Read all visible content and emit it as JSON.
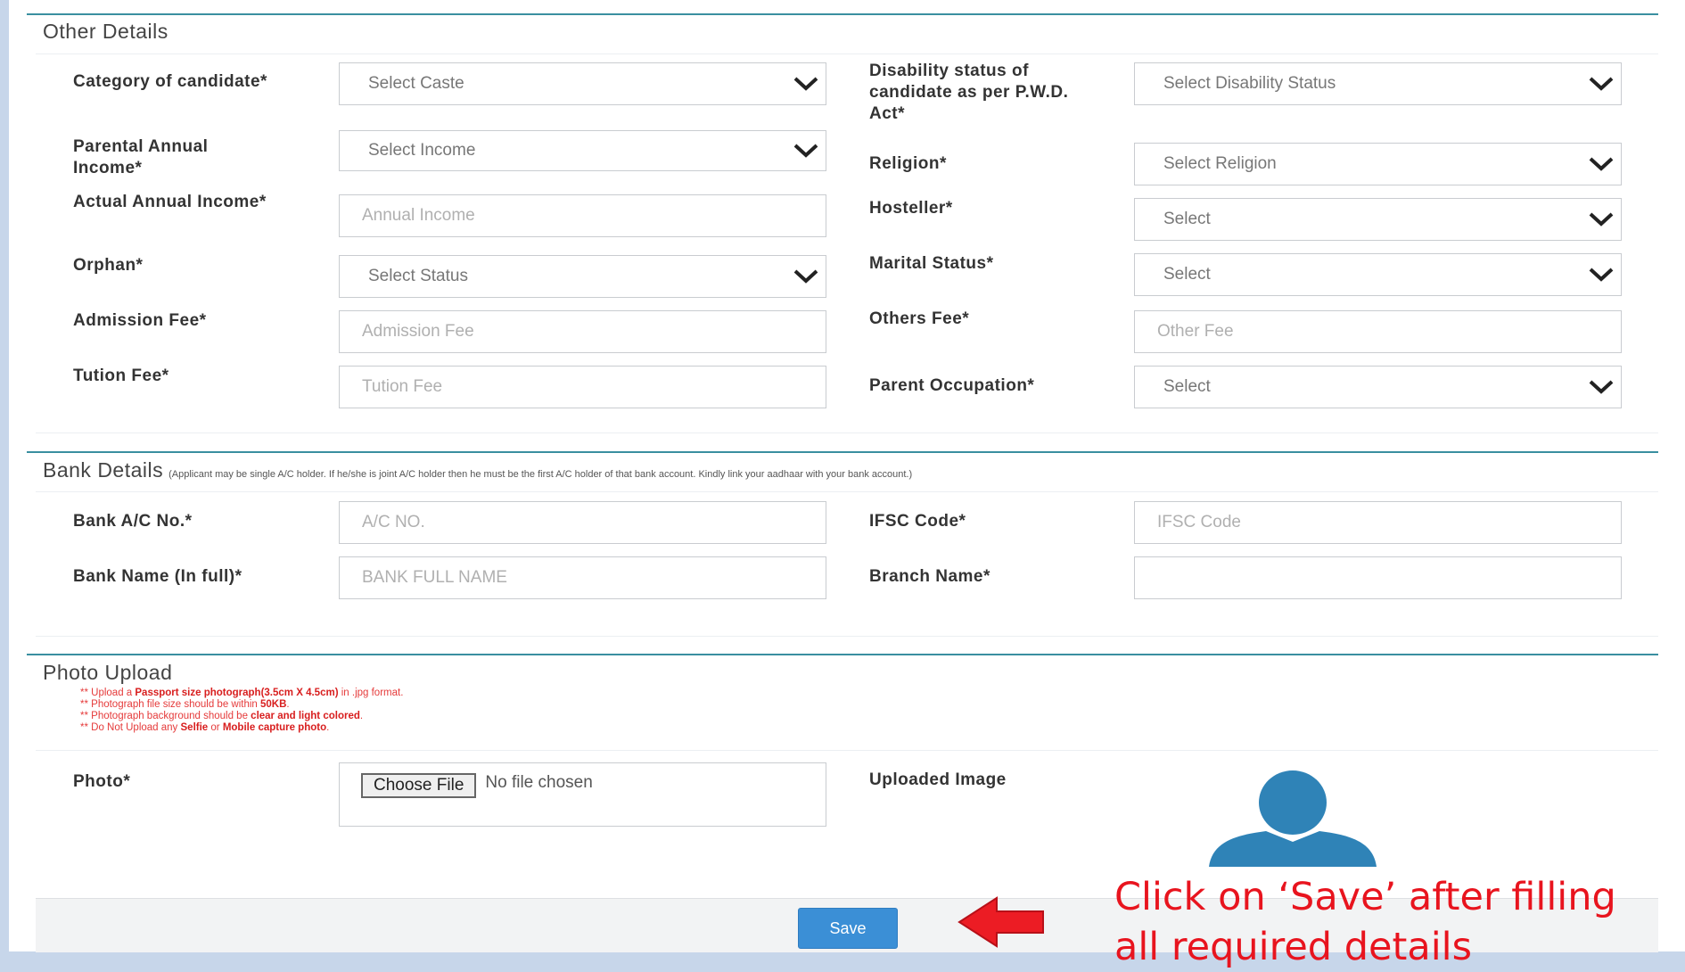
{
  "other_details": {
    "title": "Other Details",
    "fields": {
      "category": {
        "label": "Category of candidate*",
        "value": "Select Caste"
      },
      "disability": {
        "label": "Disability status of candidate as per P.W.D. Act*",
        "value": "Select Disability Status"
      },
      "parental_income": {
        "label": "Parental Annual Income*",
        "value": "Select Income"
      },
      "religion": {
        "label": "Religion*",
        "value": "Select Religion"
      },
      "actual_income": {
        "label": "Actual Annual Income*",
        "placeholder": "Annual Income"
      },
      "hosteller": {
        "label": "Hosteller*",
        "value": "Select"
      },
      "orphan": {
        "label": "Orphan*",
        "value": "Select Status"
      },
      "marital_status": {
        "label": "Marital Status*",
        "value": "Select"
      },
      "admission_fee": {
        "label": "Admission Fee*",
        "placeholder": "Admission Fee"
      },
      "others_fee": {
        "label": "Others Fee*",
        "placeholder": "Other Fee"
      },
      "tution_fee": {
        "label": "Tution Fee*",
        "placeholder": "Tution Fee"
      },
      "parent_occupation": {
        "label": "Parent Occupation*",
        "value": "Select"
      }
    }
  },
  "bank_details": {
    "title": "Bank Details",
    "note": "(Applicant may be single A/C holder. If he/she is joint A/C holder then he must be the first A/C holder of that bank account. Kindly link your aadhaar with your bank account.)",
    "fields": {
      "account_no": {
        "label": "Bank A/C No.*",
        "placeholder": "A/C NO."
      },
      "ifsc": {
        "label": "IFSC Code*",
        "placeholder": "IFSC Code"
      },
      "bank_name": {
        "label": "Bank Name (In full)*",
        "placeholder": "BANK FULL NAME"
      },
      "branch_name": {
        "label": "Branch Name*",
        "placeholder": ""
      }
    }
  },
  "photo_upload": {
    "title": "Photo Upload",
    "notes": [
      {
        "prefix": "** Upload a ",
        "bold": "Passport size photograph(3.5cm X 4.5cm)",
        "suffix": " in .jpg format."
      },
      {
        "prefix": "** Photograph file size should be within ",
        "bold": "50KB",
        "suffix": "."
      },
      {
        "prefix": "** Photograph background should be ",
        "bold": "clear and light colored",
        "suffix": "."
      },
      {
        "prefix": "** Do Not Upload any ",
        "bold": "Selfie",
        "suffix": " or ",
        "bold2": "Mobile capture photo",
        "suffix2": "."
      }
    ],
    "photo_label": "Photo*",
    "choose_file": "Choose File",
    "file_status": "No file chosen",
    "uploaded_label": "Uploaded Image"
  },
  "footer": {
    "save_label": "Save"
  },
  "annotation": {
    "line1": "Click on ‘Save’ after filling",
    "line2": "all required details"
  },
  "colors": {
    "section_rule": "#3a8fa0",
    "save_button": "#3b8fd6",
    "notes_red": "#e53a3a",
    "annotation_red": "#e8141e",
    "avatar_blue": "#2f83b7"
  },
  "icons": {
    "dropdown": "chevron-down-icon",
    "avatar": "user-silhouette-icon",
    "arrow": "left-arrow-icon"
  }
}
